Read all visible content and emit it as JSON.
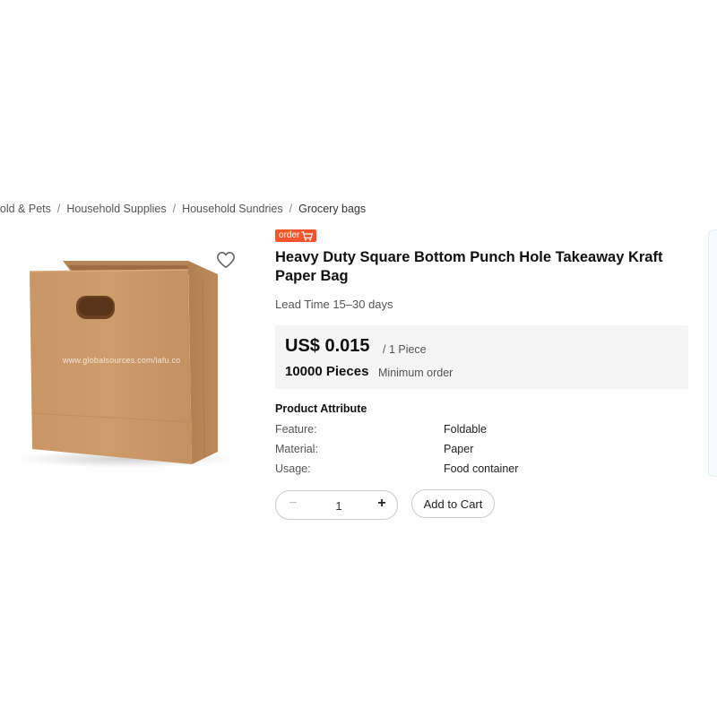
{
  "breadcrumb": {
    "items": [
      "ehold & Pets",
      "Household Supplies",
      "Household Sundries",
      "Grocery bags"
    ]
  },
  "product": {
    "badge": "order",
    "badge_color": "#f2542d",
    "title": "Heavy Duty Square Bottom Punch Hole Takeaway Kraft Paper Bag",
    "lead_time": "Lead Time 15–30 days",
    "image_watermark": "www.globalsources.com/lafu.co",
    "favorite_icon": "heart-icon"
  },
  "pricing": {
    "price": "US$ 0.015",
    "unit": "/ 1 Piece",
    "moq_qty": "10000 Pieces",
    "moq_label": "Minimum order"
  },
  "attributes": {
    "title": "Product Attribute",
    "rows": [
      {
        "key": "Feature:",
        "value": "Foldable"
      },
      {
        "key": "Material:",
        "value": "Paper"
      },
      {
        "key": "Usage:",
        "value": "Food container"
      }
    ]
  },
  "cart": {
    "quantity": "1",
    "minus_symbol": "−",
    "plus_symbol": "+",
    "add_label": "Add to Cart"
  }
}
